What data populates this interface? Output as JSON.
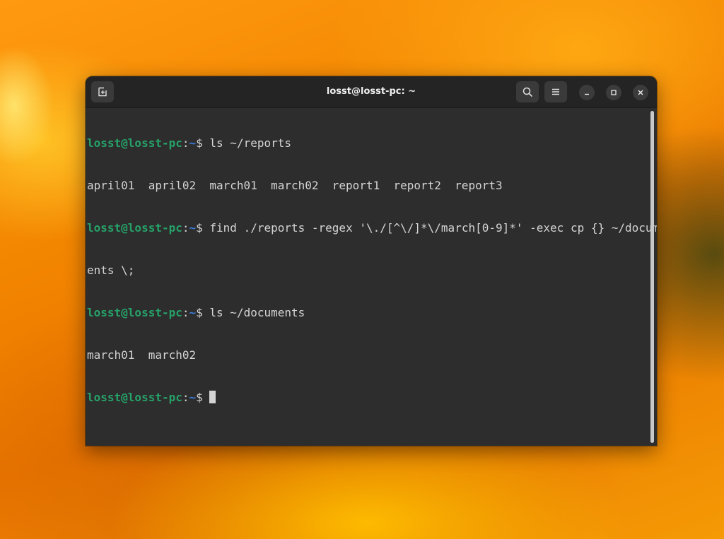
{
  "window": {
    "title": "losst@losst-pc: ~"
  },
  "headerbar": {
    "new_tab_icon": "tab-new-icon",
    "search_icon": "search-icon",
    "menu_icon": "hamburger-menu-icon"
  },
  "window_controls": [
    "minimize-icon",
    "maximize-icon",
    "close-icon"
  ],
  "prompt": {
    "user_host": "losst@losst-pc",
    "separator": ":",
    "path": "~",
    "symbol": "$ "
  },
  "terminal": {
    "lines": [
      {
        "type": "prompt",
        "command": "ls ~/reports"
      },
      {
        "type": "output",
        "text": "april01  april02  march01  march02  report1  report2  report3"
      },
      {
        "type": "prompt",
        "command": "find ./reports -regex '\\./[^\\/]*\\/march[0-9]*' -exec cp {} ~/docum"
      },
      {
        "type": "output",
        "text": "ents \\;"
      },
      {
        "type": "prompt",
        "command": "ls ~/documents"
      },
      {
        "type": "output",
        "text": "march01  march02"
      },
      {
        "type": "prompt",
        "command": ""
      }
    ]
  },
  "colors": {
    "prompt_user": "#26a269",
    "prompt_path": "#3b7ad9",
    "terminal_bg": "#2d2d2d",
    "terminal_fg": "#d4d4d4",
    "headerbar_bg": "#242424"
  }
}
